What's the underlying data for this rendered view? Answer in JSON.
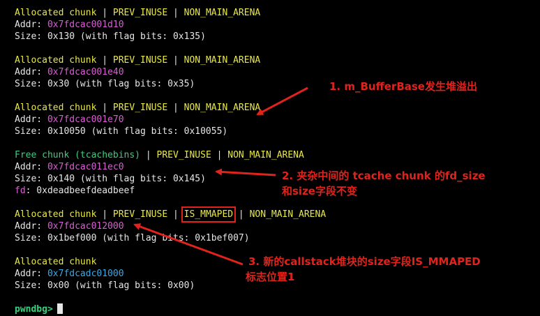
{
  "chunks": [
    {
      "type": "Allocated chunk",
      "sep1": " | ",
      "flag1": "PREV_INUSE",
      "sep2": " | ",
      "flag2": "NON_MAIN_ARENA",
      "addr_label": "Addr: ",
      "addr": "0x7fdcac001d10",
      "size_text": "Size: 0x130 (with flag bits: 0x135)"
    },
    {
      "type": "Allocated chunk",
      "sep1": " | ",
      "flag1": "PREV_INUSE",
      "sep2": " | ",
      "flag2": "NON_MAIN_ARENA",
      "addr_label": "Addr: ",
      "addr": "0x7fdcac001e40",
      "size_text": "Size: 0x30 (with flag bits: 0x35)"
    },
    {
      "type": "Allocated chunk",
      "sep1": " | ",
      "flag1": "PREV_INUSE",
      "sep2": " | ",
      "flag2": "NON_MAIN_ARENA",
      "addr_label": "Addr: ",
      "addr": "0x7fdcac001e70",
      "size_text": "Size: 0x10050 (with flag bits: 0x10055)"
    },
    {
      "type": "Free chunk (tcachebins)",
      "sep1": " | ",
      "flag1": "PREV_INUSE",
      "sep2": " | ",
      "flag2": "NON_MAIN_ARENA",
      "addr_label": "Addr: ",
      "addr": "0x7fdcac011ec0",
      "size_text": "Size: 0x140 (with flag bits: 0x145)",
      "fd_label": "fd",
      "fd_value": ": 0xdeadbeefdeadbeef"
    },
    {
      "type": "Allocated chunk",
      "sep1": " | ",
      "flag1": "PREV_INUSE",
      "sep2": " | ",
      "flag_boxed": "IS_MMAPED",
      "sep3": " | ",
      "flag2": "NON_MAIN_ARENA",
      "addr_label": "Addr: ",
      "addr": "0x7fdcac012000",
      "size_text": "Size: 0x1bef000 (with flag bits: 0x1bef007)"
    },
    {
      "type": "Allocated chunk",
      "addr_label": "Addr: ",
      "addr": "0x7fdcadc01000",
      "size_text": "Size: 0x00 (with flag bits: 0x00)"
    }
  ],
  "prompt": "pwndbg>",
  "annotations": {
    "a1": "1. m_BufferBase发生堆溢出",
    "a2_line1": "2. 夹杂中间的 tcache chunk 的fd_size",
    "a2_line2": "和size字段不变",
    "a3_line1": "3. 新的callstack堆块的size字段IS_MMAPED",
    "a3_line2": "标志位置1"
  },
  "colors": {
    "background": "#000000",
    "header_yellow": "#e8e84a",
    "free_green": "#39d17f",
    "addr_magenta": "#d85fd4",
    "addr_cyan": "#3aa9e8",
    "annotation_red": "#e0231c"
  }
}
